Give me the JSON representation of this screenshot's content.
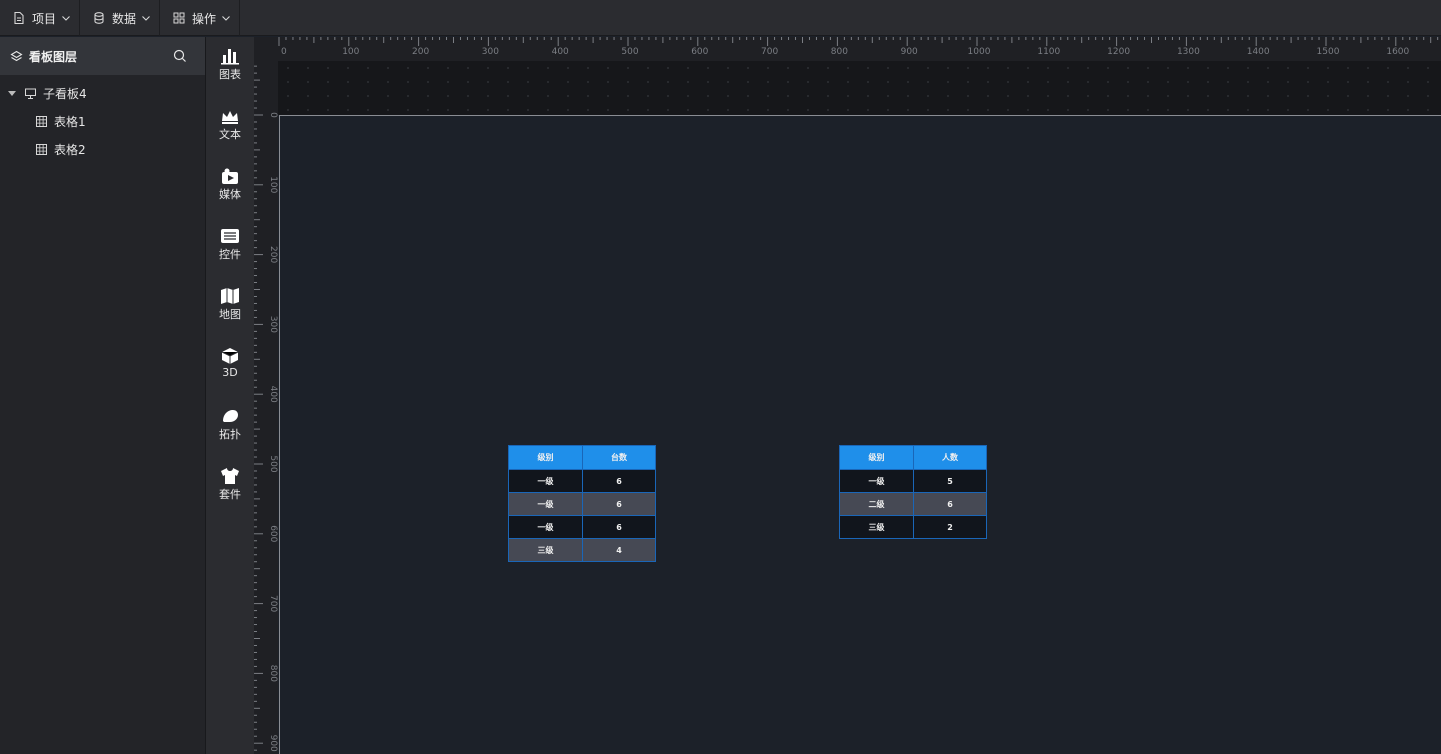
{
  "menubar": {
    "items": [
      {
        "label": "项目",
        "icon": "document-icon"
      },
      {
        "label": "数据",
        "icon": "database-icon"
      },
      {
        "label": "操作",
        "icon": "grid-icon"
      }
    ]
  },
  "layers": {
    "title": "看板图层",
    "tree": {
      "root": "子看板4",
      "children": [
        "表格1",
        "表格2"
      ]
    }
  },
  "toolbox": {
    "items": [
      {
        "label": "图表",
        "icon": "bar-chart-icon"
      },
      {
        "label": "文本",
        "icon": "crown-icon"
      },
      {
        "label": "媒体",
        "icon": "media-icon"
      },
      {
        "label": "控件",
        "icon": "controls-icon"
      },
      {
        "label": "地图",
        "icon": "map-icon"
      },
      {
        "label": "3D",
        "icon": "cube-icon"
      },
      {
        "label": "拓扑",
        "icon": "topology-icon"
      },
      {
        "label": "套件",
        "icon": "shirt-icon"
      }
    ]
  },
  "rulers": {
    "top": [
      "0",
      "100",
      "200",
      "300",
      "400",
      "500",
      "600",
      "700",
      "800",
      "900",
      "1000",
      "1100",
      "1200",
      "1300",
      "1400",
      "1500",
      "1600"
    ],
    "left": [
      "0",
      "100",
      "200",
      "300",
      "400",
      "500",
      "600",
      "700",
      "800",
      "900"
    ]
  },
  "tables": [
    {
      "headers": [
        "级别",
        "台数"
      ],
      "rows": [
        [
          "一级",
          "6"
        ],
        [
          "一级",
          "6"
        ],
        [
          "一级",
          "6"
        ],
        [
          "三级",
          "4"
        ]
      ]
    },
    {
      "headers": [
        "级别",
        "人数"
      ],
      "rows": [
        [
          "一级",
          "5"
        ],
        [
          "二级",
          "6"
        ],
        [
          "三级",
          "2"
        ]
      ]
    }
  ],
  "colors": {
    "table_header": "#1f8fea",
    "table_border": "#1a66b8",
    "canvas_bg": "#1c2129"
  }
}
